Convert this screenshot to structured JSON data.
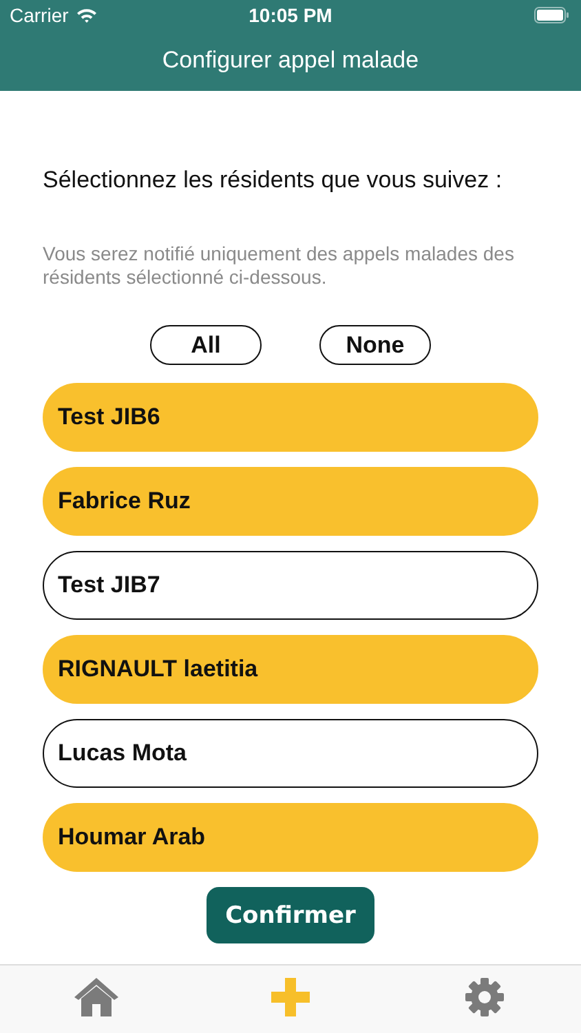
{
  "status_bar": {
    "carrier": "Carrier",
    "time": "10:05 PM"
  },
  "nav": {
    "title": "Configurer appel malade"
  },
  "heading": "Sélectionnez les résidents que vous suivez :",
  "hint": "Vous serez notifié uniquement des appels malades des résidents sélectionné ci-dessous.",
  "quick_buttons": [
    "All",
    "None"
  ],
  "residents": [
    {
      "name": "Test JIB6",
      "selected": true
    },
    {
      "name": "Fabrice Ruz",
      "selected": true
    },
    {
      "name": "Test JIB7",
      "selected": false
    },
    {
      "name": "RIGNAULT laetitia",
      "selected": true
    },
    {
      "name": "Lucas Mota",
      "selected": false
    },
    {
      "name": "Houmar Arab",
      "selected": true
    }
  ],
  "confirm_button": "Confirmer",
  "tabs": [
    {
      "kind": "home",
      "selected": false
    },
    {
      "kind": "add",
      "selected": true
    },
    {
      "kind": "settings",
      "selected": false
    }
  ]
}
